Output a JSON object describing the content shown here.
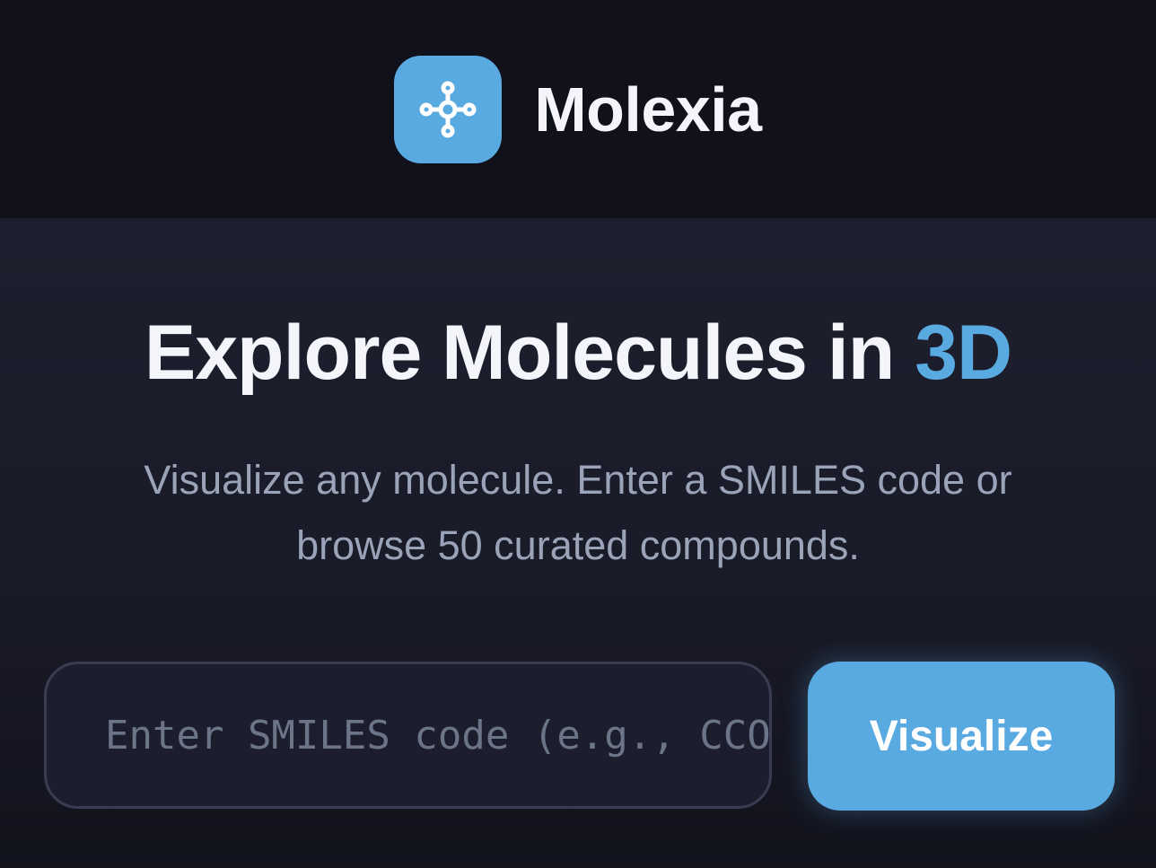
{
  "header": {
    "logo_icon": "molecule-icon",
    "brand_name": "Molexia"
  },
  "hero": {
    "title_main": "Explore Molecules in ",
    "title_accent": "3D",
    "subtitle": "Visualize any molecule. Enter a SMILES code or browse 50 curated compounds."
  },
  "search": {
    "placeholder": "Enter SMILES code (e.g., CCO for ethanol)",
    "value": "",
    "button_label": "Visualize"
  },
  "colors": {
    "accent": "#5aaae2",
    "header_bg": "#10111b",
    "body_bg": "#1e1f2e"
  }
}
